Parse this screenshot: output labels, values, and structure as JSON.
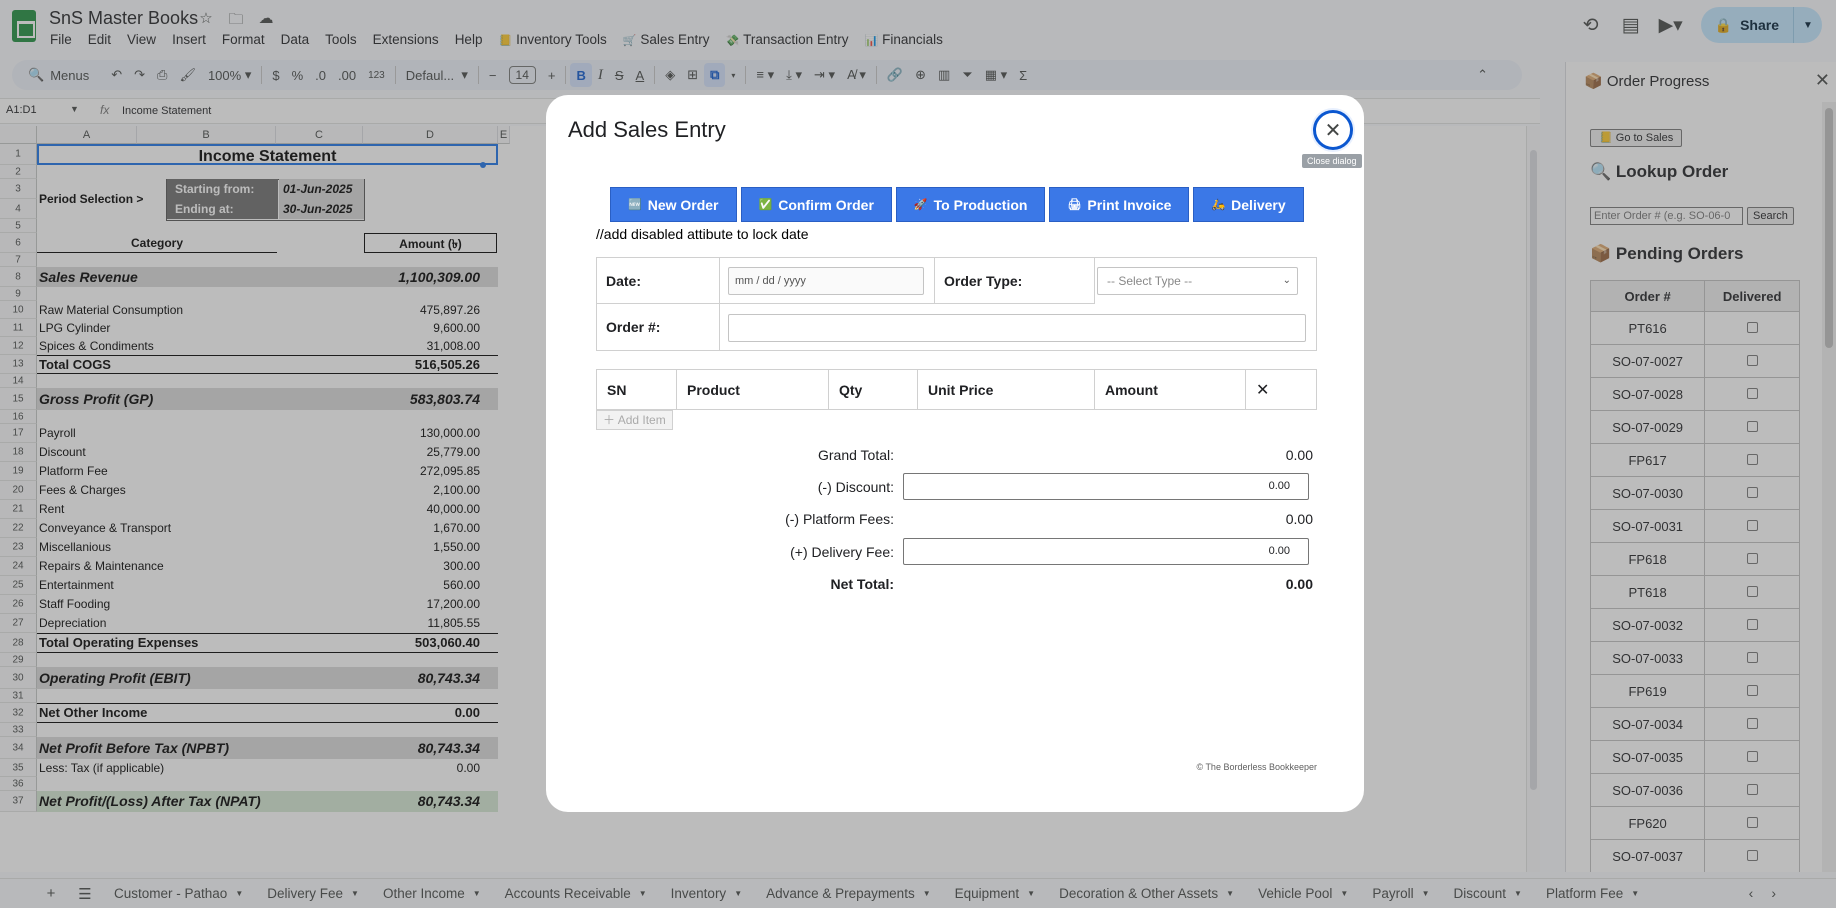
{
  "app": {
    "title": "SnS Master Books",
    "menus": [
      "File",
      "Edit",
      "View",
      "Insert",
      "Format",
      "Data",
      "Tools",
      "Extensions",
      "Help"
    ],
    "custom_menus": [
      {
        "emoji": "📒",
        "label": "Inventory Tools"
      },
      {
        "emoji": "🛒",
        "label": "Sales Entry"
      },
      {
        "emoji": "💸",
        "label": "Transaction Entry"
      },
      {
        "emoji": "📊",
        "label": "Financials"
      }
    ],
    "share_label": "Share",
    "accent_color": "#0b57d0",
    "share_color": "#c2e7ff"
  },
  "toolbar": {
    "menus_label": "Menus",
    "zoom": "100%",
    "currency": "$",
    "percent": "%",
    "dec_less": ".0",
    "dec_more": ".00",
    "number_fmt": "123",
    "font": "Defaul...",
    "font_size": "14"
  },
  "formula_bar": {
    "range": "A1:D1",
    "content": "Income Statement"
  },
  "columns": [
    "A",
    "B",
    "C",
    "D",
    "E"
  ],
  "sheet": {
    "title": "Income Statement",
    "period_label": "Period Selection >",
    "start_label": "Starting from:",
    "start_value": "01-Jun-2025",
    "end_label": "Ending at:",
    "end_value": "30-Jun-2025",
    "category_header": "Category",
    "amount_header": "Amount (৳)",
    "sales_revenue_label": "Sales Revenue",
    "sales_revenue_value": "1,100,309.00",
    "cogs": [
      {
        "label": "Raw Material Consumption",
        "value": "475,897.26"
      },
      {
        "label": "LPG Cylinder",
        "value": "9,600.00"
      },
      {
        "label": "Spices & Condiments",
        "value": "31,008.00"
      }
    ],
    "total_cogs_label": "Total COGS",
    "total_cogs_value": "516,505.26",
    "gross_profit_label": "Gross Profit (GP)",
    "gross_profit_value": "583,803.74",
    "opex": [
      {
        "label": "Payroll",
        "value": "130,000.00"
      },
      {
        "label": "Discount",
        "value": "25,779.00"
      },
      {
        "label": "Platform Fee",
        "value": "272,095.85"
      },
      {
        "label": "Fees & Charges",
        "value": "2,100.00"
      },
      {
        "label": "Rent",
        "value": "40,000.00"
      },
      {
        "label": "Conveyance & Transport",
        "value": "1,670.00"
      },
      {
        "label": "Miscellanious",
        "value": "1,550.00"
      },
      {
        "label": "Repairs & Maintenance",
        "value": "300.00"
      },
      {
        "label": "Entertainment",
        "value": "560.00"
      },
      {
        "label": "Staff Fooding",
        "value": "17,200.00"
      },
      {
        "label": "Depreciation",
        "value": "11,805.55"
      }
    ],
    "total_opex_label": "Total Operating Expenses",
    "total_opex_value": "503,060.40",
    "ebit_label": "Operating Profit (EBIT)",
    "ebit_value": "80,743.34",
    "other_income_label": "Net Other Income",
    "other_income_value": "0.00",
    "npbt_label": "Net Profit Before Tax (NPBT)",
    "npbt_value": "80,743.34",
    "tax_label": "Less: Tax (if applicable)",
    "tax_value": "0.00",
    "npat_label": "Net Profit/(Loss) After Tax (NPAT)",
    "npat_value": "80,743.34"
  },
  "rows": [
    "1",
    "2",
    "3",
    "4",
    "5",
    "6",
    "7",
    "8",
    "9",
    "10",
    "11",
    "12",
    "13",
    "14",
    "15",
    "16",
    "17",
    "18",
    "19",
    "20",
    "21",
    "22",
    "23",
    "24",
    "25",
    "26",
    "27",
    "28",
    "29",
    "30",
    "31",
    "32",
    "33",
    "34",
    "35",
    "36",
    "37"
  ],
  "modal": {
    "title": "Add Sales Entry",
    "close_tooltip": "Close dialog",
    "buttons": [
      {
        "icon": "🆕",
        "label": "New Order"
      },
      {
        "icon": "✅",
        "label": "Confirm Order"
      },
      {
        "icon": "🚀",
        "label": "To Production"
      },
      {
        "icon": "🖨",
        "label": "Print Invoice"
      },
      {
        "icon": "🛵",
        "label": "Delivery"
      }
    ],
    "button_color": "#3b78e7",
    "note": "//add disabled attibute to lock date",
    "date_label": "Date:",
    "date_placeholder": "mm / dd / yyyy",
    "order_type_label": "Order Type:",
    "order_type_placeholder": "-- Select Type --",
    "order_no_label": "Order #:",
    "order_no_value": "",
    "item_headers": [
      "SN",
      "Product",
      "Qty",
      "Unit Price",
      "Amount",
      "✕"
    ],
    "add_item_label": "Add Item",
    "grand_total_label": "Grand Total:",
    "grand_total_value": "0.00",
    "discount_label": "(-) Discount:",
    "discount_value": "0.00",
    "platform_fees_label": "(-) Platform Fees:",
    "platform_fees_value": "0.00",
    "delivery_fee_label": "(+) Delivery Fee:",
    "delivery_fee_value": "0.00",
    "net_total_label": "Net Total:",
    "net_total_value": "0.00",
    "footer": "© The Borderless Bookkeeper"
  },
  "panel": {
    "title": "Order Progress",
    "title_icon": "📦",
    "go_to_sales": "Go to Sales",
    "lookup_title": "Lookup Order",
    "lookup_placeholder": "Enter Order # (e.g. SO-06-0",
    "search_label": "Search",
    "pending_title": "Pending Orders",
    "col_order": "Order #",
    "col_delivered": "Delivered",
    "orders": [
      "PT616",
      "SO-07-0027",
      "SO-07-0028",
      "SO-07-0029",
      "FP617",
      "SO-07-0030",
      "SO-07-0031",
      "FP618",
      "PT618",
      "SO-07-0032",
      "SO-07-0033",
      "FP619",
      "SO-07-0034",
      "SO-07-0035",
      "SO-07-0036",
      "FP620",
      "SO-07-0037"
    ]
  },
  "sheet_tabs": [
    "Customer - Pathao",
    "Delivery Fee",
    "Other Income",
    "Accounts Receivable",
    "Inventory",
    "Advance & Prepayments",
    "Equipment",
    "Decoration & Other Assets",
    "Vehicle Pool",
    "Payroll",
    "Discount",
    "Platform Fee"
  ]
}
